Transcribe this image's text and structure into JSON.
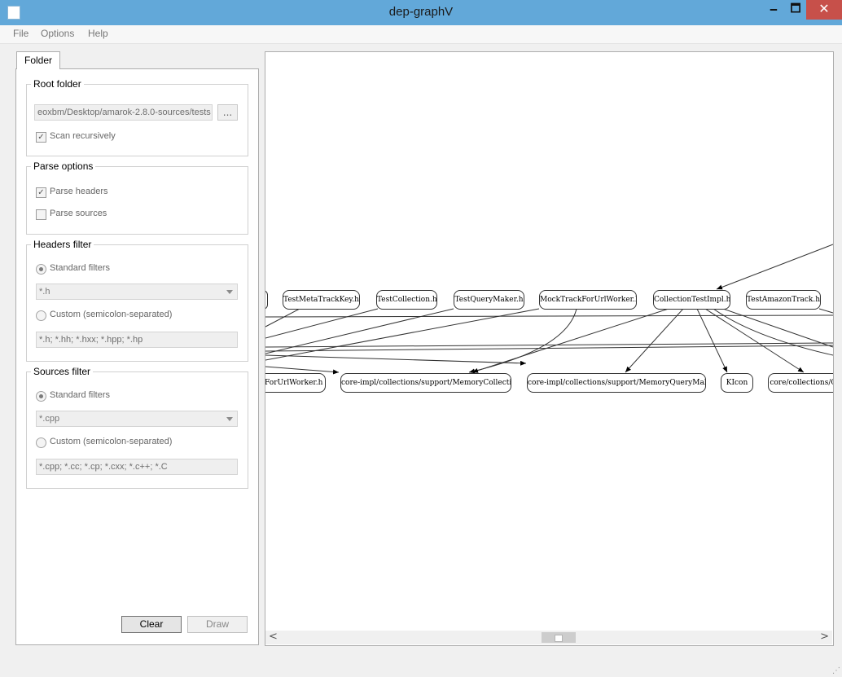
{
  "window": {
    "title": "dep-graphV",
    "min_label": "🗕",
    "max_label": "🗖",
    "close_label": "✕"
  },
  "menu": [
    "File",
    "Options",
    "Help"
  ],
  "tab": {
    "label": "Folder"
  },
  "root_folder": {
    "title": "Root folder",
    "path": "eoxbm/Desktop/amarok-2.8.0-sources/tests",
    "browse_label": "...",
    "scan_recursively": {
      "label": "Scan recursively",
      "checked": true
    }
  },
  "parse_options": {
    "title": "Parse options",
    "parse_headers": {
      "label": "Parse headers",
      "checked": true
    },
    "parse_sources": {
      "label": "Parse sources",
      "checked": false
    }
  },
  "headers_filter": {
    "title": "Headers filter",
    "standard_label": "Standard filters",
    "standard_selected": true,
    "standard_value": "*.h",
    "custom_label": "Custom (semicolon-separated)",
    "custom_value": "*.h; *.hh; *.hxx; *.hpp; *.hp"
  },
  "sources_filter": {
    "title": "Sources filter",
    "standard_label": "Standard filters",
    "standard_selected": true,
    "standard_value": "*.cpp",
    "custom_label": "Custom (semicolon-separated)",
    "custom_value": "*.cpp; *.cc; *.cp; *.cxx; *.c++; *.C"
  },
  "buttons": {
    "clear": "Clear",
    "draw": "Draw"
  },
  "graph": {
    "top_nodes": [
      "TestMetaTrackKey.h",
      "TestCollection.h",
      "TestQueryMaker.h",
      "MockTrackForUrlWorker.h",
      "CollectionTestImpl.h",
      "TestAmazonTrack.h"
    ],
    "bottom_nodes": [
      "kForUrlWorker.h",
      "core-impl/collections/support/MemoryCollection.h",
      "core-impl/collections/support/MemoryQueryMaker.h",
      "KIcon",
      "core/collections/Co"
    ]
  },
  "scrollbar": {
    "left_arrow": "<",
    "right_arrow": ">"
  },
  "icons": [
    "app-icon",
    "check-icon",
    "chevron-down-icon",
    "scroll-left-icon",
    "scroll-right-icon",
    "size-grip-icon"
  ]
}
